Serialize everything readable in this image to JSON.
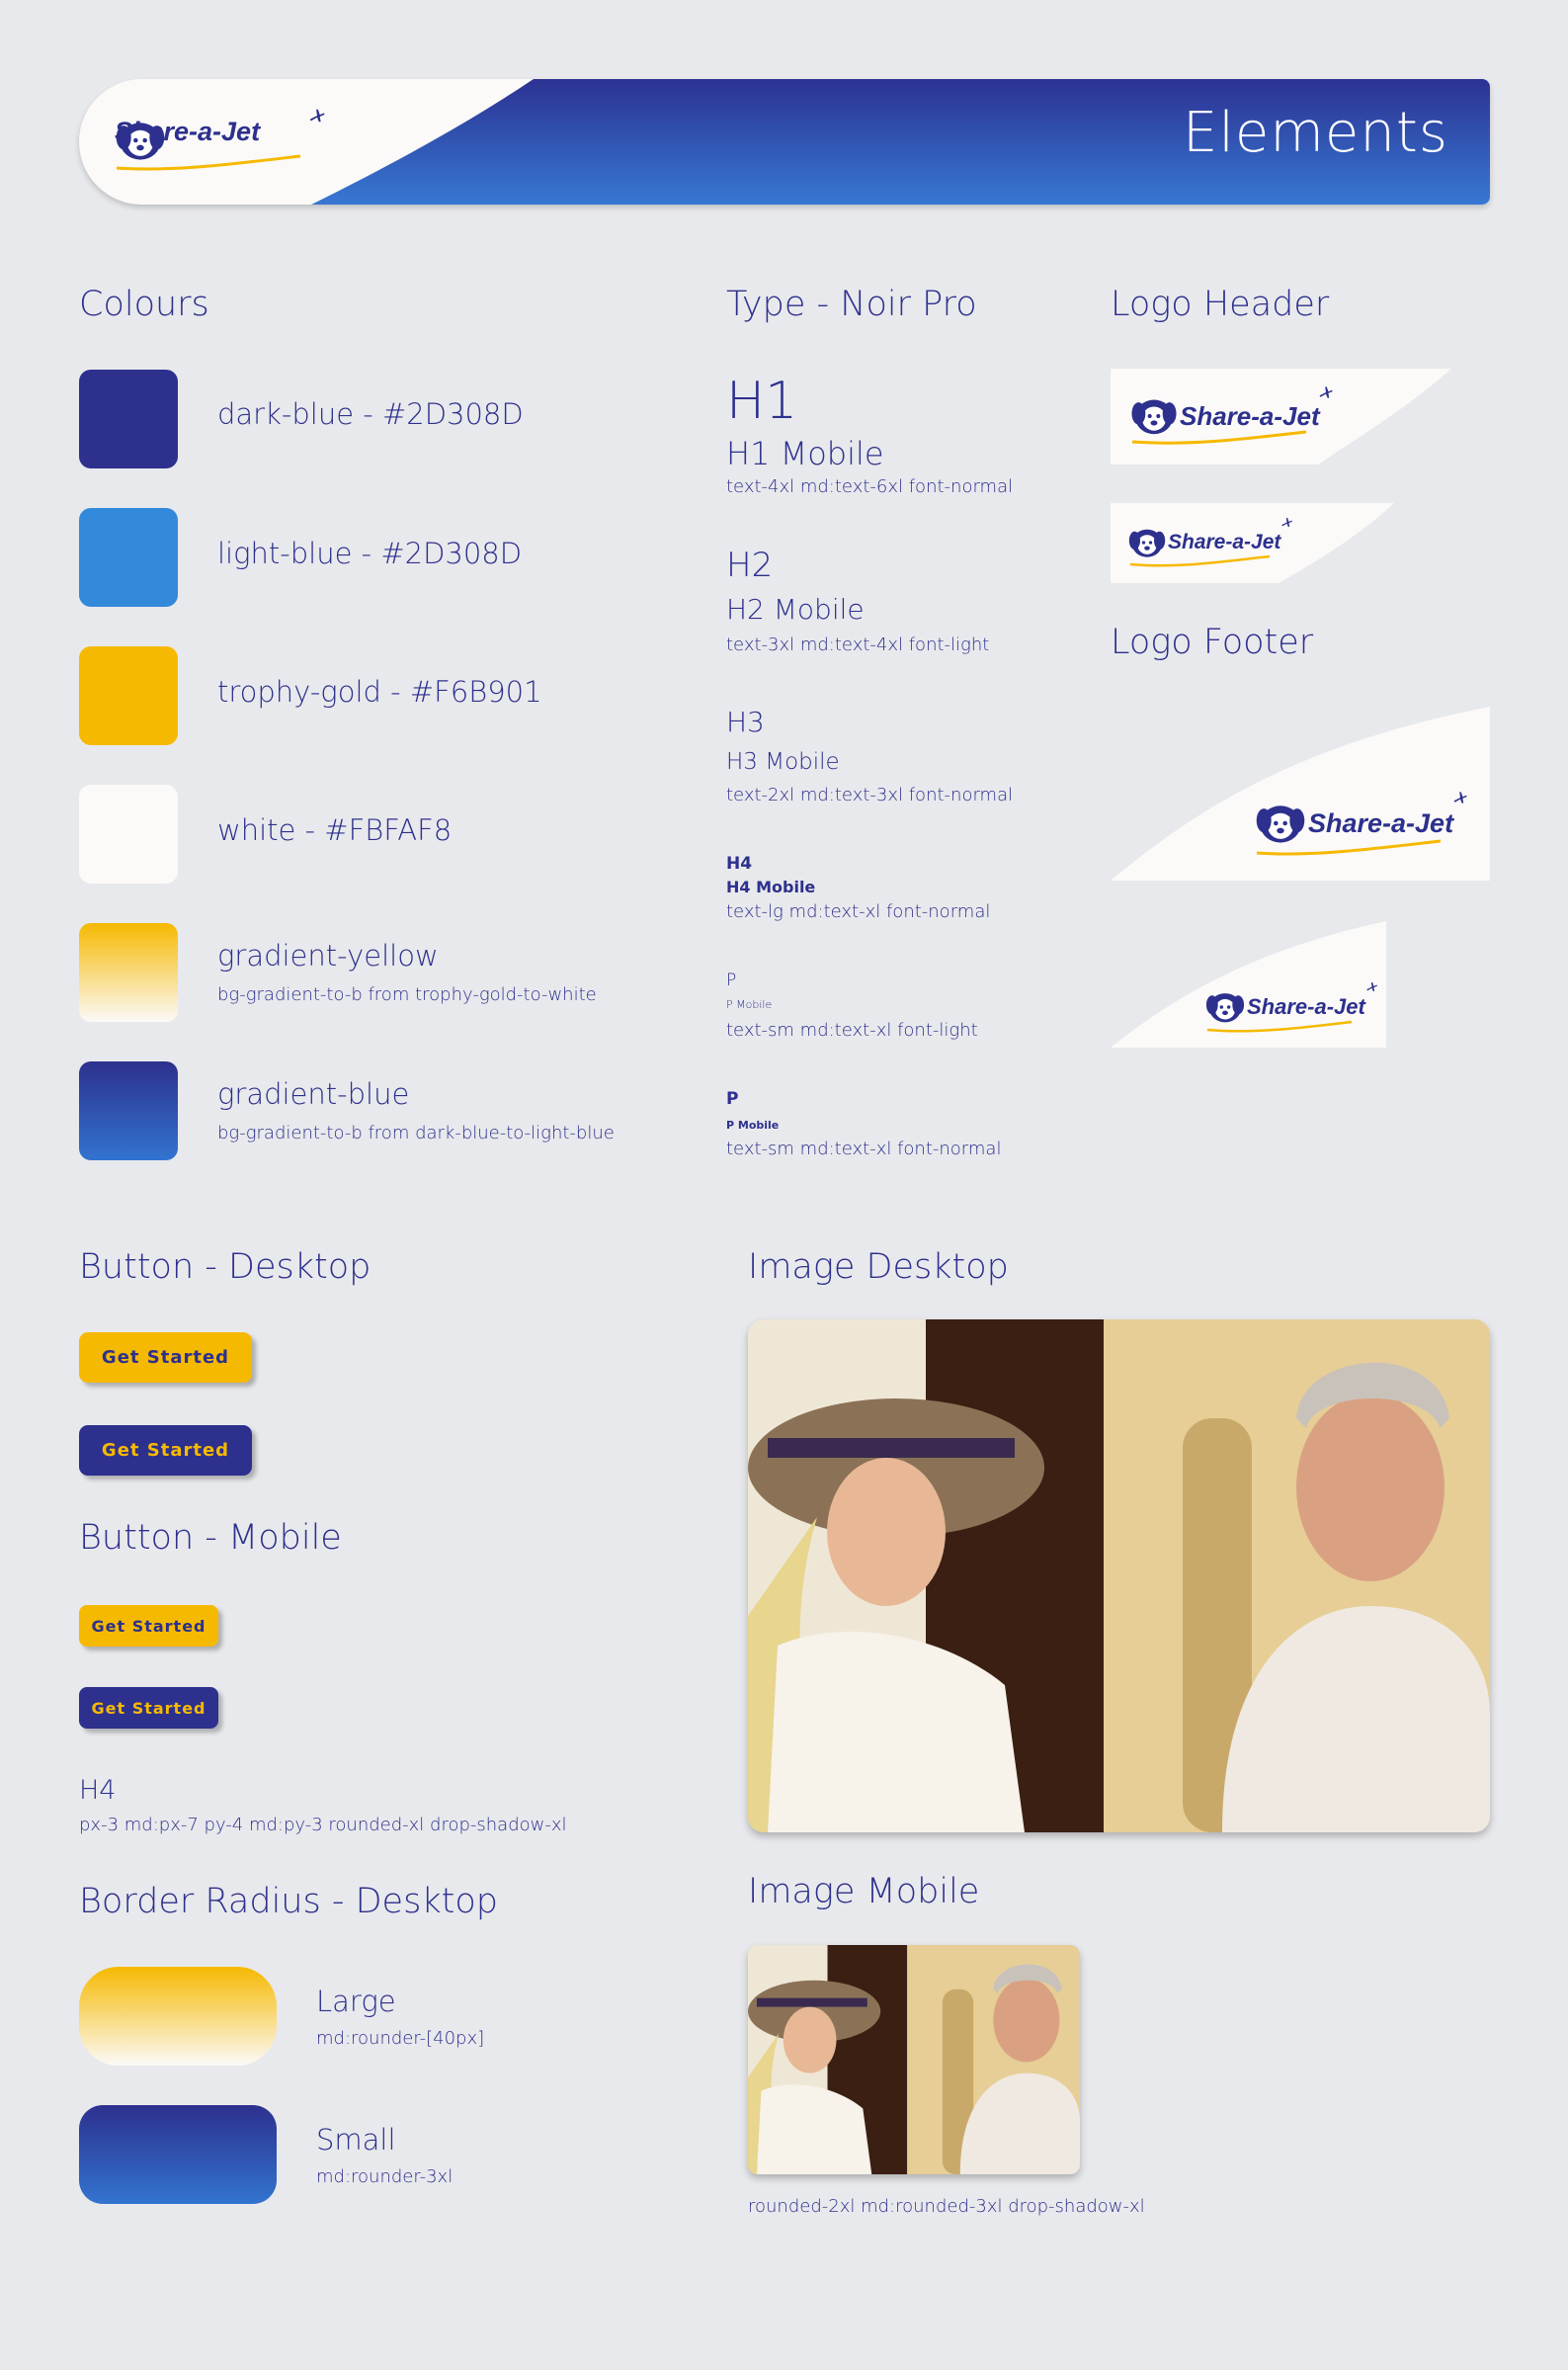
{
  "banner": {
    "title": "Elements",
    "logo_text": "Share-a-Jet"
  },
  "colours": {
    "title": "Colours",
    "items": [
      {
        "label": "dark-blue - #2D308D",
        "sub": "",
        "color": "#2D308D"
      },
      {
        "label": "light-blue - #2D308D",
        "sub": "",
        "color": "#3389D9"
      },
      {
        "label": "trophy-gold - #F6B901",
        "sub": "",
        "color": "#F6B901"
      },
      {
        "label": "white - #FBFAF8",
        "sub": "",
        "color": "#FBFAF8"
      },
      {
        "label": "gradient-yellow",
        "sub": "bg-gradient-to-b from trophy-gold-to-white",
        "color": "gradient-yellow"
      },
      {
        "label": "gradient-blue",
        "sub": "bg-gradient-to-b from dark-blue-to-light-blue",
        "color": "gradient-blue"
      }
    ]
  },
  "type": {
    "title": "Type - Noir Pro",
    "h1": "H1",
    "h1_mobile": "H1 Mobile",
    "h1_classes": "text-4xl md:text-6xl font-normal",
    "h2": "H2",
    "h2_mobile": "H2 Mobile",
    "h2_classes": "text-3xl md:text-4xl font-light",
    "h3": "H3",
    "h3_mobile": "H3 Mobile",
    "h3_classes": "text-2xl md:text-3xl font-normal",
    "h4": "H4",
    "h4_mobile": "H4 Mobile",
    "h4_classes": "text-lg md:text-xl font-normal",
    "p1": "P",
    "p1_mobile": "P Mobile",
    "p1_classes": "text-sm md:text-xl font-light",
    "p2": "P",
    "p2_mobile": "P Mobile",
    "p2_classes": "text-sm md:text-xl font-normal"
  },
  "logo_header": {
    "title": "Logo Header",
    "text": "Share-a-Jet"
  },
  "logo_footer": {
    "title": "Logo Footer",
    "text": "Share-a-Jet"
  },
  "button_desktop": {
    "title": "Button - Desktop",
    "primary": "Get Started",
    "secondary": "Get Started"
  },
  "button_mobile": {
    "title": "Button - Mobile",
    "primary": "Get Started",
    "secondary": "Get Started"
  },
  "button_spec": {
    "heading": "H4",
    "classes": "px-3 md:px-7 py-4 md:py-3 rounded-xl drop-shadow-xl"
  },
  "border_radius": {
    "title": "Border Radius - Desktop",
    "large": {
      "label": "Large",
      "classes": "md:rounder-[40px]"
    },
    "small": {
      "label": "Small",
      "classes": "md:rounder-3xl"
    }
  },
  "image_desktop": {
    "title": "Image Desktop"
  },
  "image_mobile": {
    "title": "Image Mobile",
    "caption": "rounded-2xl md:rounded-3xl drop-shadow-xl"
  },
  "palette": {
    "dark_blue": "#2D308D",
    "light_blue": "#3389D9",
    "gold": "#F6B901",
    "white": "#FBFAF8",
    "page_bg": "#E8E9EC"
  }
}
